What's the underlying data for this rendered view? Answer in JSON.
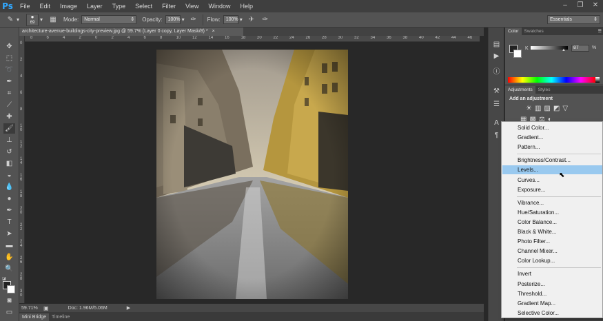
{
  "app": {
    "logo": "Ps"
  },
  "menu": [
    "File",
    "Edit",
    "Image",
    "Layer",
    "Type",
    "Select",
    "Filter",
    "View",
    "Window",
    "Help"
  ],
  "window_controls": [
    "–",
    "❐",
    "✕"
  ],
  "options": {
    "brush_size": "69",
    "mode_label": "Mode:",
    "mode_value": "Normal",
    "opacity_label": "Opacity:",
    "opacity_value": "100%",
    "flow_label": "Flow:",
    "flow_value": "100%",
    "workspace": "Essentials"
  },
  "document": {
    "tab_title": "architecture-avenue-buildings-city-preview.jpg @ 59.7% (Layer 0 copy, Layer Mask/8) *",
    "close": "×",
    "zoom": "59.71%",
    "doc_info": "Doc: 1.96M/5.06M"
  },
  "rulers": {
    "top": [
      "8",
      "6",
      "4",
      "2",
      "0",
      "2",
      "4",
      "6",
      "8",
      "10",
      "12",
      "14",
      "16",
      "18",
      "20",
      "22",
      "24",
      "26",
      "28",
      "30",
      "32",
      "34",
      "36",
      "38",
      "40",
      "42",
      "44",
      "46"
    ],
    "left": [
      "0",
      "2",
      "4",
      "6",
      "8",
      "1 0",
      "1 2",
      "1 4",
      "1 6",
      "1 8",
      "2 0",
      "2 2",
      "2 4",
      "2 6",
      "2 8",
      "3 0"
    ]
  },
  "bottom_tabs": [
    "Mini Bridge",
    "Timeline"
  ],
  "color_panel": {
    "tabs": [
      "Color",
      "Swatches"
    ],
    "channel": "K",
    "value": "87",
    "unit": "%"
  },
  "adjustments_panel": {
    "tabs": [
      "Adjustments",
      "Styles"
    ],
    "heading": "Add an adjustment"
  },
  "dropdown": {
    "groups": [
      [
        "Solid Color...",
        "Gradient...",
        "Pattern..."
      ],
      [
        "Brightness/Contrast...",
        "Levels...",
        "Curves...",
        "Exposure..."
      ],
      [
        "Vibrance...",
        "Hue/Saturation...",
        "Color Balance...",
        "Black & White...",
        "Photo Filter...",
        "Channel Mixer...",
        "Color Lookup..."
      ],
      [
        "Invert",
        "Posterize...",
        "Threshold...",
        "Gradient Map...",
        "Selective Color..."
      ]
    ],
    "highlighted": "Levels..."
  },
  "colors": {
    "highlight": "#99c9ef",
    "ps_blue": "#31a8ff"
  }
}
